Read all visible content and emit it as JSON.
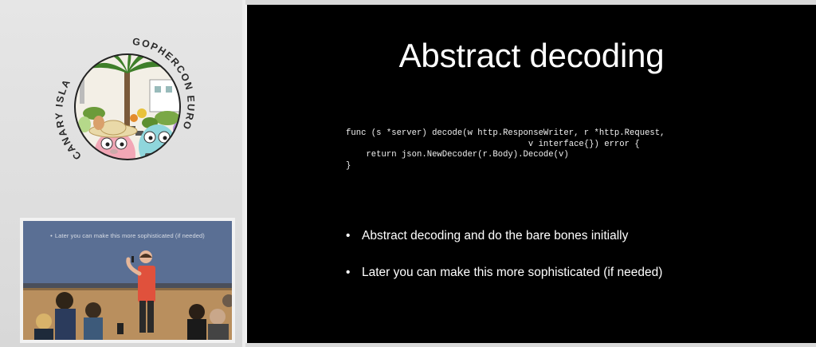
{
  "logo": {
    "ring_text_right": "GOPHERCON EUROPE",
    "ring_text_left": "CANARY ISLANDS"
  },
  "speaker_feed": {
    "caption_bullet": "•",
    "caption": "Later you can make this more sophisticated (if needed)"
  },
  "slide": {
    "title": "Abstract decoding",
    "code": "func (s *server) decode(w http.ResponseWriter, r *http.Request,\n                                    v interface{}) error {\n    return json.NewDecoder(r.Body).Decode(v)\n}",
    "bullet_glyph": "•",
    "bullets": [
      "Abstract decoding and do the bare bones initially",
      "Later you can make this more sophisticated (if needed)"
    ]
  },
  "colors": {
    "slide_bg": "#000000",
    "slide_text": "#ffffff",
    "page_bg": "#d9d9d9"
  }
}
